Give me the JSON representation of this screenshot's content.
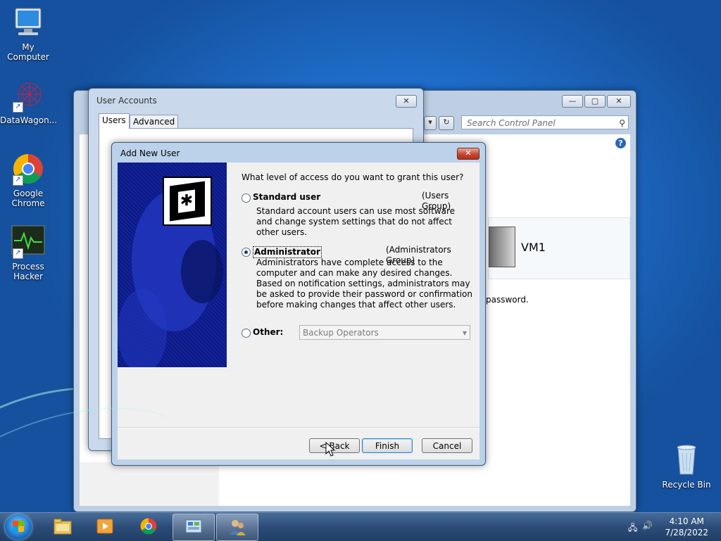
{
  "desktop": {
    "icons": [
      {
        "label": "My Computer"
      },
      {
        "label": "DataWagon..."
      },
      {
        "label": "Google Chrome"
      },
      {
        "label": "Process Hacker"
      },
      {
        "label": "Recycle Bin"
      }
    ]
  },
  "control_panel": {
    "search_placeholder": "Search Control Panel",
    "vm_name": "VM1",
    "password_text": "password."
  },
  "user_accounts": {
    "title": "User Accounts",
    "tabs": [
      "Users",
      "Advanced"
    ]
  },
  "dialog": {
    "title": "Add New User",
    "question": "What level of access do you want to grant this user?",
    "standard": {
      "label": "Standard user",
      "group": "(Users Group)",
      "desc": "Standard account users can use most software and change system settings that do not affect other users."
    },
    "administrator": {
      "label": "Administrator",
      "group": "(Administrators Group)",
      "desc": "Administrators have complete access to the computer and can make any desired changes. Based on notification settings, administrators may be asked to provide their password or confirmation before making changes that affect other users."
    },
    "other": {
      "label": "Other:",
      "selected": "Backup Operators"
    },
    "selected_option": "Administrator",
    "buttons": {
      "back": "< Back",
      "finish": "Finish",
      "cancel": "Cancel"
    }
  },
  "taskbar": {
    "time": "4:10 AM",
    "date": "7/28/2022"
  }
}
